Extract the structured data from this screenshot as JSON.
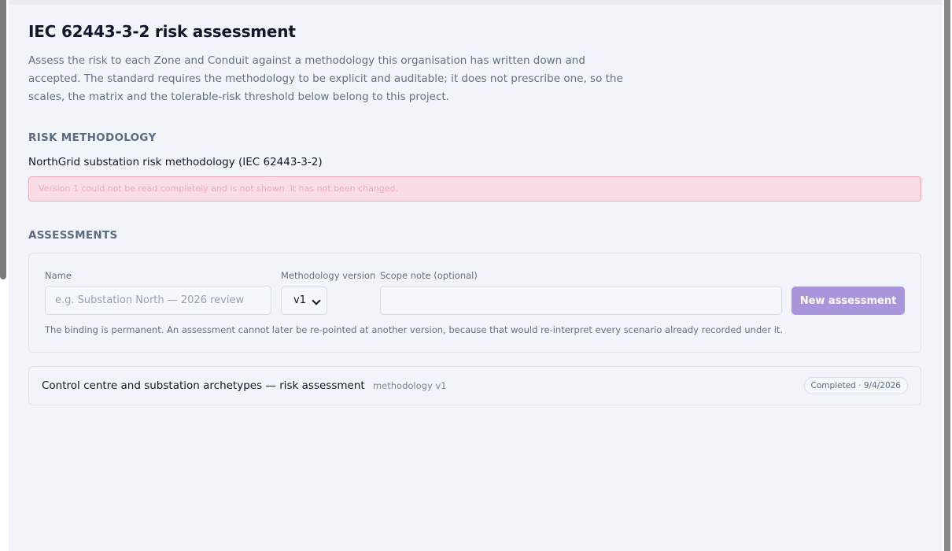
{
  "page": {
    "title": "IEC 62443-3-2 risk assessment",
    "intro": "Assess the risk to each Zone and Conduit against a methodology this organisation has written down and accepted. The standard requires the methodology to be explicit and auditable; it does not prescribe one, so the scales, the matrix and the tolerable-risk threshold below belong to this project."
  },
  "methodology": {
    "heading": "RISK METHODOLOGY",
    "name": "NorthGrid substation risk methodology (IEC 62443-3-2)",
    "error": "Version 1 could not be read completely and is not shown. It has not been changed."
  },
  "assessments": {
    "heading": "ASSESSMENTS",
    "form": {
      "name_label": "Name",
      "name_placeholder": "e.g. Substation North — 2026 review",
      "version_label": "Methodology version",
      "version_value": "v1",
      "scope_label": "Scope note (optional)",
      "scope_value": "",
      "submit_label": "New assessment",
      "note": "The binding is permanent. An assessment cannot later be re-pointed at another version, because that would re-interpret every scenario already recorded under it."
    },
    "items": [
      {
        "title": "Control centre and substation archetypes — risk assessment",
        "methodology": "methodology v1",
        "status": "Completed · 9/4/2026"
      }
    ]
  },
  "colors": {
    "background": "#f1f4f9",
    "accent_button": "#a995dc",
    "error_bg": "#f8dde5",
    "error_border": "#f2a7b8"
  },
  "icons": {
    "version_select": "chevron-down-icon"
  }
}
